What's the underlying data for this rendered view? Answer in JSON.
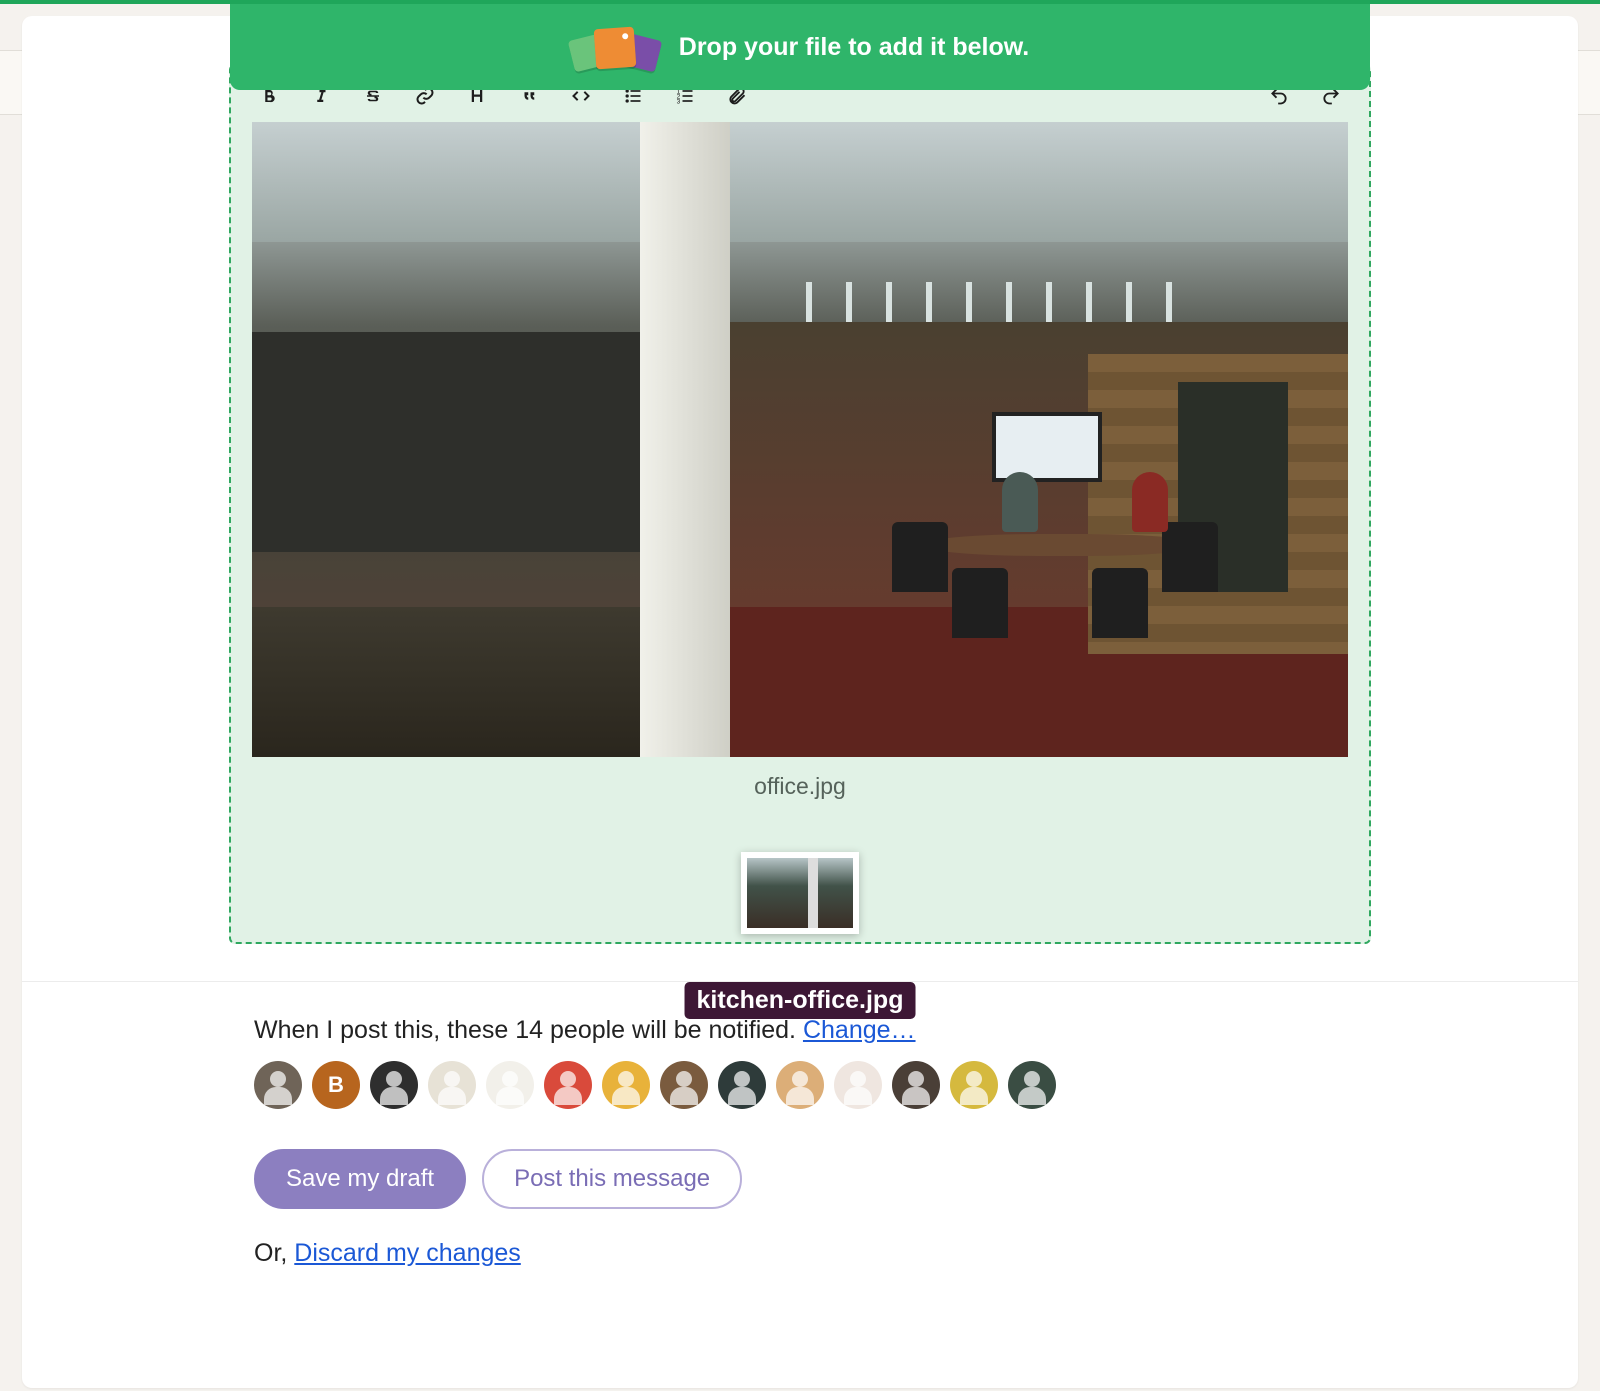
{
  "banner": {
    "text": "Drop your file to add it below."
  },
  "editor": {
    "attached_image_caption": "office.jpg",
    "dragging_file_label": "kitchen-office.jpg"
  },
  "notify": {
    "prefix": "When I post this, these ",
    "count": "14",
    "suffix": " people will be notified. ",
    "change_link": "Change…"
  },
  "avatars": [
    {
      "bg": "#6f6458",
      "initial": ""
    },
    {
      "bg": "#b7651e",
      "initial": "B"
    },
    {
      "bg": "#2e2e2e",
      "initial": ""
    },
    {
      "bg": "#e7e2d6",
      "initial": ""
    },
    {
      "bg": "#f2f0ea",
      "initial": ""
    },
    {
      "bg": "#d94a3b",
      "initial": ""
    },
    {
      "bg": "#e8b23a",
      "initial": ""
    },
    {
      "bg": "#7a5b3e",
      "initial": ""
    },
    {
      "bg": "#2e3b3a",
      "initial": ""
    },
    {
      "bg": "#dcae78",
      "initial": ""
    },
    {
      "bg": "#efe6e0",
      "initial": ""
    },
    {
      "bg": "#4a3f37",
      "initial": ""
    },
    {
      "bg": "#d5b93e",
      "initial": ""
    },
    {
      "bg": "#3a4d43",
      "initial": ""
    }
  ],
  "actions": {
    "save_draft": "Save my draft",
    "post_message": "Post this message",
    "or_prefix": "Or, ",
    "discard": "Discard my changes"
  }
}
